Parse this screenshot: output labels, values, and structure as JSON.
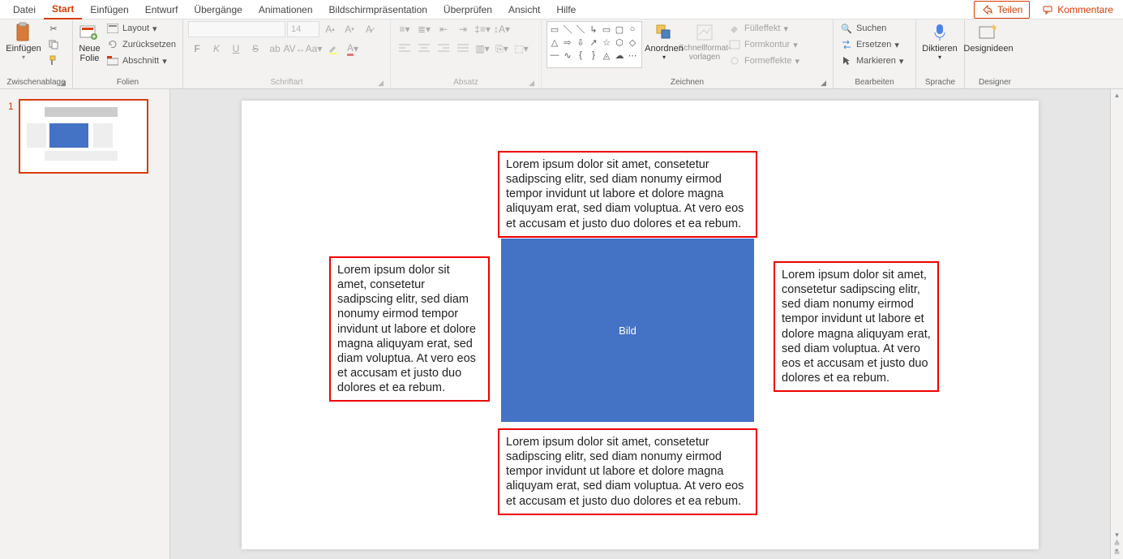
{
  "tabs": {
    "datei": "Datei",
    "start": "Start",
    "einfuegen": "Einfügen",
    "entwurf": "Entwurf",
    "uebergaenge": "Übergänge",
    "animationen": "Animationen",
    "bildschirm": "Bildschirmpräsentation",
    "ueberpruefen": "Überprüfen",
    "ansicht": "Ansicht",
    "hilfe": "Hilfe"
  },
  "topright": {
    "share": "Teilen",
    "comments": "Kommentare"
  },
  "ribbon": {
    "clipboard": {
      "label": "Zwischenablage",
      "paste": "Einfügen"
    },
    "slides": {
      "label": "Folien",
      "newslide": "Neue\nFolie",
      "layout": "Layout",
      "reset": "Zurücksetzen",
      "section": "Abschnitt"
    },
    "font": {
      "label": "Schriftart",
      "size": "14",
      "bold": "F",
      "italic": "K",
      "underline": "U",
      "strike": "S"
    },
    "paragraph": {
      "label": "Absatz"
    },
    "drawing": {
      "label": "Zeichnen",
      "arrange": "Anordnen",
      "quickstyles": "Schnellformat-\nvorlagen",
      "fill": "Fülleffekt",
      "outline": "Formkontur",
      "effects": "Formeffekte"
    },
    "editing": {
      "label": "Bearbeiten",
      "search": "Suchen",
      "replace": "Ersetzen",
      "select": "Markieren"
    },
    "voice": {
      "label": "Sprache",
      "dictate": "Diktieren"
    },
    "designer": {
      "label": "Designer",
      "ideas": "Designideen"
    }
  },
  "thumbnails": {
    "num1": "1"
  },
  "slide": {
    "lorem": "Lorem ipsum dolor sit amet, consetetur sadipscing elitr, sed diam nonumy eirmod tempor invidunt ut labore et dolore magna aliquyam erat, sed diam voluptua. At vero eos et accusam et justo duo dolores et ea rebum.",
    "bild": "Bild"
  }
}
